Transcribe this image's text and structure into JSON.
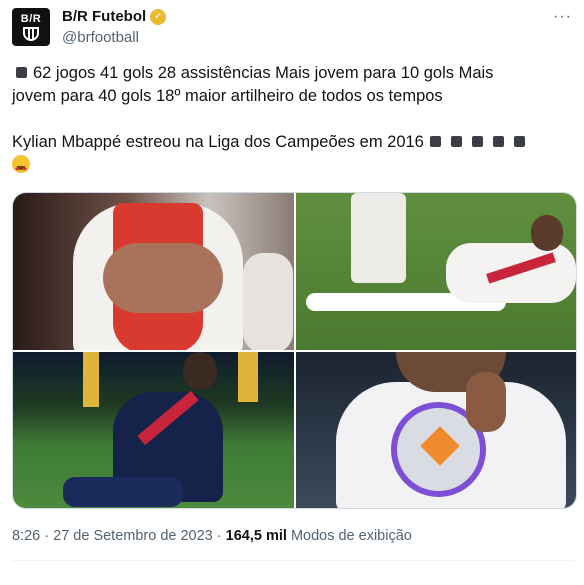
{
  "author": {
    "display_name": "B/R Futebol",
    "handle": "@brfootball",
    "avatar_text": "B/R",
    "verified_color": "#e8b931"
  },
  "more_label": "···",
  "tweet": {
    "line1": "62 jogos  41 gols  28 assistências  Mais jovem para 10 gols  Mais",
    "line2": "jovem para 40  gols   18º maior artilheiro de todos os tempos",
    "line3": "Kylian Mbappé estreou na Liga dos Campeões em 2016",
    "emoji": "star-struck-emoji"
  },
  "media": {
    "photos": [
      {
        "name": "photo-mbappe-monaco-shirt"
      },
      {
        "name": "photo-mbappe-lying-on-pitch"
      },
      {
        "name": "photo-mbappe-knee-slide"
      },
      {
        "name": "photo-mbappe-holding-ball"
      }
    ]
  },
  "meta": {
    "time": "8:26",
    "date": "27 de Setembro de 2023",
    "views_count": "164,5 mil",
    "views_label": "Modos de exibição"
  }
}
